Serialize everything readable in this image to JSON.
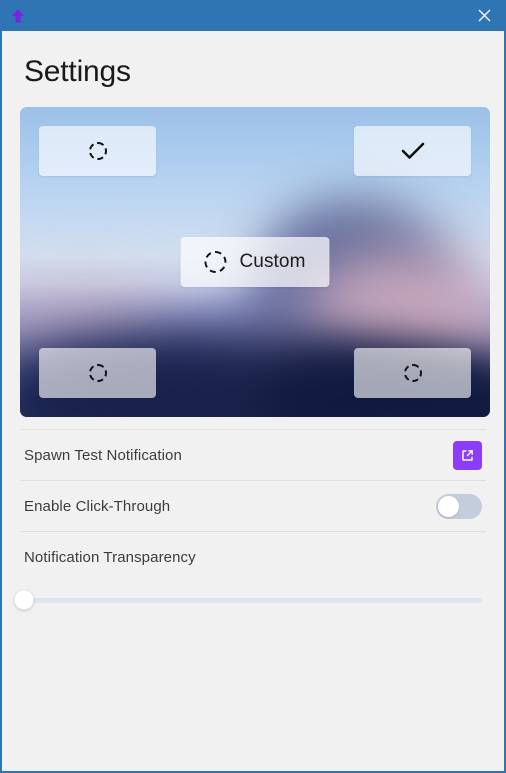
{
  "window": {
    "titlebar_title": "",
    "app_icon": "up-arrow-icon",
    "close_icon": "close-icon",
    "accent_blue": "#2f74b3",
    "accent_purple": "#8b3dfa"
  },
  "page": {
    "title": "Settings"
  },
  "position_picker": {
    "name": "notification-position-picker",
    "selected": "top-right",
    "options": [
      {
        "id": "top-left",
        "icon": "dashed-circle-icon",
        "selected": false
      },
      {
        "id": "top-right",
        "icon": "check-icon",
        "selected": true
      },
      {
        "id": "bottom-left",
        "icon": "dashed-circle-icon",
        "selected": false
      },
      {
        "id": "bottom-right",
        "icon": "dashed-circle-icon",
        "selected": false
      }
    ],
    "custom": {
      "label": "Custom",
      "icon": "dashed-circle-icon",
      "selected": false
    }
  },
  "settings": {
    "rows": [
      {
        "label": "Spawn Test Notification",
        "control": "external-link-button",
        "icon": "external-link-icon"
      },
      {
        "label": "Enable Click-Through",
        "control": "toggle",
        "value": "off"
      },
      {
        "label": "Notification Transparency",
        "control": "slider",
        "value": 0,
        "min": 0,
        "max": 100
      }
    ]
  }
}
